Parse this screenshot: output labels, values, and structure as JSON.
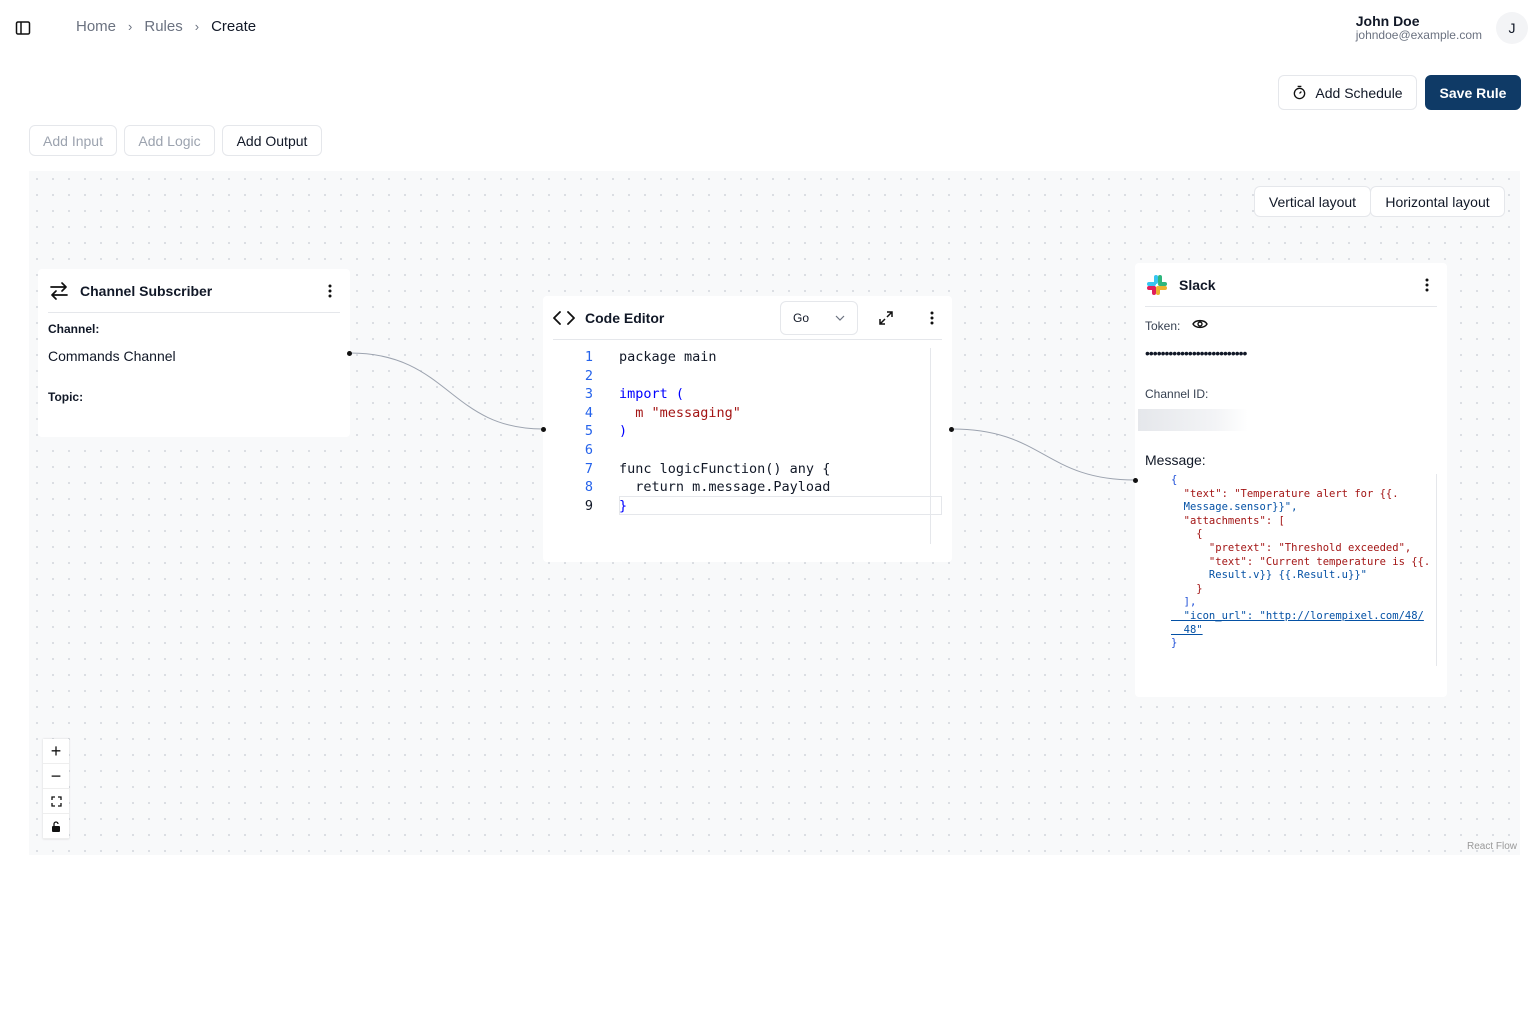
{
  "header": {
    "breadcrumb": [
      "Home",
      "Rules",
      "Create"
    ],
    "user_name": "John Doe",
    "user_email": "johndoe@example.com",
    "avatar_initial": "J"
  },
  "actions": {
    "add_schedule": "Add Schedule",
    "save_rule": "Save Rule",
    "add_input": "Add Input",
    "add_logic": "Add Logic",
    "add_output": "Add Output"
  },
  "layout_buttons": {
    "vertical": "Vertical layout",
    "horizontal": "Horizontal layout"
  },
  "subscriber_node": {
    "title": "Channel Subscriber",
    "channel_label": "Channel:",
    "channel_value": "Commands Channel",
    "topic_label": "Topic:"
  },
  "code_node": {
    "title": "Code Editor",
    "language": "Go",
    "active_line": 9,
    "lines": [
      "package main",
      "",
      "import (",
      "  m \"messaging\"",
      ")",
      "",
      "func logicFunction() any {",
      "  return m.message.Payload",
      "}"
    ]
  },
  "slack_node": {
    "title": "Slack",
    "token_label": "Token:",
    "token_value": "••••••••••••••••••••••••••",
    "channel_id_label": "Channel ID:",
    "message_label": "Message:",
    "message_lines": [
      "{",
      "  \"text\": \"Temperature alert for {{.",
      "  Message.sensor}}\",",
      "  \"attachments\": [",
      "    {",
      "      \"pretext\": \"Threshold exceeded\",",
      "      \"text\": \"Current temperature is {{.",
      "      Result.v}} {{.Result.u}}\"",
      "    }",
      "  ],",
      "  \"icon_url\": \"http://lorempixel.com/48/",
      "  48\"",
      "}"
    ]
  },
  "canvas": {
    "attribution": "React Flow"
  }
}
